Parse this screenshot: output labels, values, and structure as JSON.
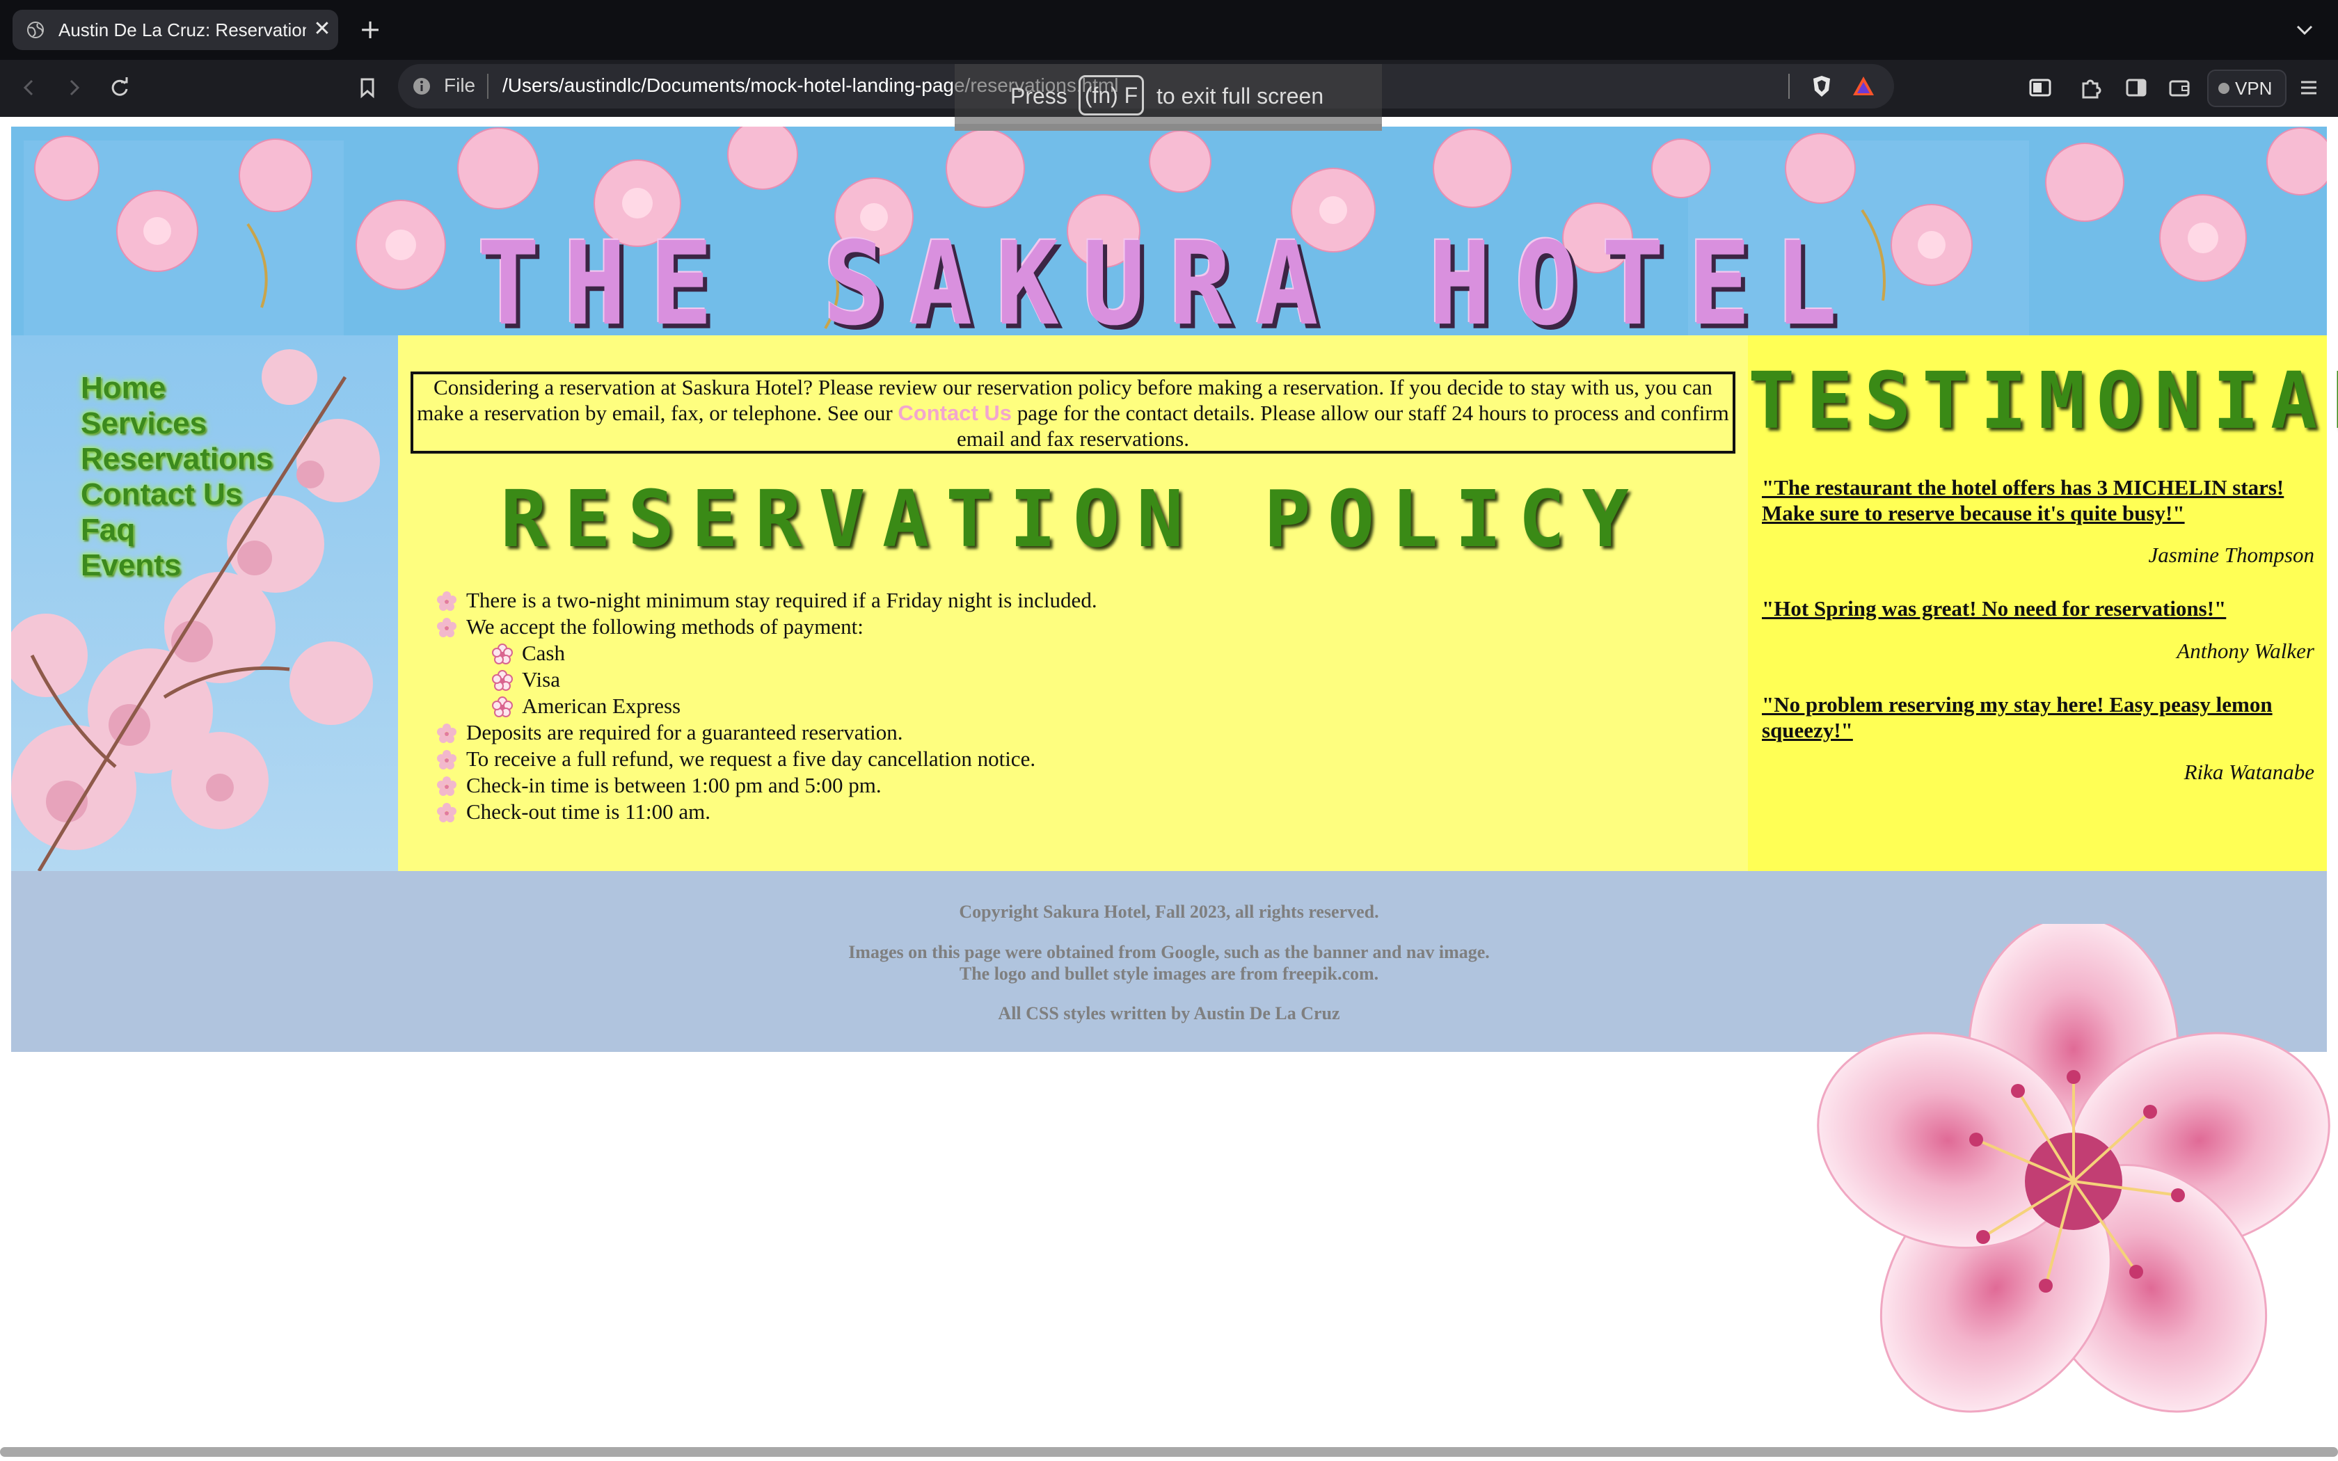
{
  "browser": {
    "tab_title": "Austin De La Cruz: Reservations",
    "new_tab": "+",
    "close": "✕",
    "url_scheme": "File",
    "url_path": "/Users/austindlc/Documents/mock-hotel-landing-page/reservations.html",
    "vpn_label": "VPN",
    "fullscreen_hint": {
      "before": "Press",
      "key": "(fn) F",
      "after": "to exit full screen"
    }
  },
  "banner": {
    "title": "THE SAKURA HOTEL"
  },
  "nav": {
    "items": [
      "Home",
      "Services",
      "Reservations",
      "Contact Us",
      "Faq",
      "Events"
    ]
  },
  "intro": {
    "before_link": "Considering a reservation at Saskura Hotel? Please review our reservation policy before making a reservation. If you decide to stay with us, you can make a reservation by email, fax, or telephone. See our",
    "link": "Contact Us",
    "after_link": "page for the contact details. Please allow our staff 24 hours to process and confirm email and fax reservations."
  },
  "policy": {
    "title": "RESERVATION POLICY",
    "items": [
      "There is a two-night minimum stay required if a Friday night is included.",
      "We accept the following methods of payment:",
      "Cash",
      "Visa",
      "American Express",
      "Deposits are required for a guaranteed reservation.",
      "To receive a full refund, we request a five day cancellation notice.",
      "Check-in time is between 1:00 pm and 5:00 pm.",
      "Check-out time is 11:00 am."
    ]
  },
  "testimonials": {
    "title": "TESTIMONIALS",
    "entries": [
      {
        "quote": "\"The restaurant the hotel offers has 3 MICHELIN stars! Make sure to reserve because it's quite busy!\"",
        "author": "Jasmine Thompson"
      },
      {
        "quote": "\"Hot Spring was great! No need for reservations!\"",
        "author": "Anthony Walker"
      },
      {
        "quote": "\"No problem reserving my stay here! Easy peasy lemon squeezy!\"",
        "author": "Rika Watanabe"
      }
    ]
  },
  "footer": {
    "copyright": "Copyright Sakura Hotel, Fall 2023, all rights reserved.",
    "images_line1": "Images on this page were obtained from Google, such as the banner and nav image.",
    "images_line2": "The logo and bullet style images are from freepik.com.",
    "css_credit": "All CSS styles written by Austin De La Cruz"
  },
  "icons": {
    "tab": "globe-icon",
    "back": "back-arrow-icon",
    "forward": "forward-arrow-icon",
    "reload": "reload-icon",
    "bookmark": "bookmark-icon",
    "info": "info-icon",
    "brave": "brave-shield-icon",
    "rewards": "brave-rewards-icon",
    "reader": "reader-mode-icon",
    "extensions": "extensions-icon",
    "sidebar": "sidebar-icon",
    "wallet": "wallet-icon",
    "menu": "hamburger-menu-icon",
    "bullet": "sakura-bullet-icon",
    "sub_bullet": "sakura-outline-bullet-icon"
  },
  "colors": {
    "nav_link": "#3c8a1e",
    "main_bg": "#fefe7f",
    "testimonial_bg": "#ffff55",
    "footer_bg": "#b0c4de",
    "heading_green": "#3a8a16",
    "banner_title": "#d990de",
    "link_pink": "#f2a6cf"
  }
}
